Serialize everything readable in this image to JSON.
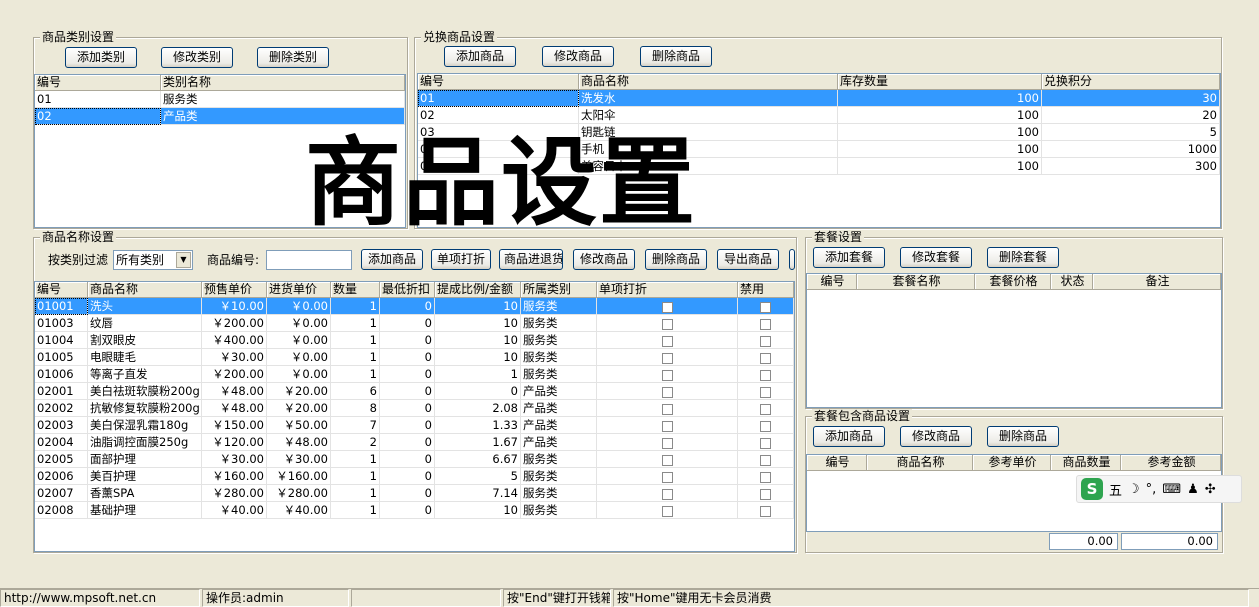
{
  "category_panel": {
    "title": "商品类别设置",
    "buttons": [
      "添加类别",
      "修改类别",
      "删除类别"
    ],
    "columns": [
      "编号",
      "类别名称"
    ],
    "rows": [
      [
        "01",
        "服务类"
      ],
      [
        "02",
        "产品类"
      ]
    ],
    "selected_row": 1
  },
  "exchange_panel": {
    "title": "兑换商品设置",
    "buttons": [
      "添加商品",
      "修改商品",
      "删除商品"
    ],
    "columns": [
      "编号",
      "商品名称",
      "库存数量",
      "兑换积分"
    ],
    "rows": [
      [
        "01",
        "洗发水",
        "100",
        "30"
      ],
      [
        "02",
        "太阳伞",
        "100",
        "20"
      ],
      [
        "03",
        "钥匙链",
        "100",
        "5"
      ],
      [
        "0",
        "手机",
        "100",
        "1000"
      ],
      [
        "0",
        "美容日卡",
        "100",
        "300"
      ]
    ],
    "selected_row": 0
  },
  "watermark": "商品设置",
  "product_panel": {
    "title": "商品名称设置",
    "filter_label": "按类别过滤",
    "filter_value": "所有类别",
    "code_label": "商品编号:",
    "code_value": "",
    "buttons": [
      "添加商品",
      "单项打折",
      "商品进退货",
      "修改商品",
      "删除商品",
      "导出商品"
    ],
    "columns": [
      "编号",
      "商品名称",
      "预售单价",
      "进货单价",
      "数量",
      "最低折扣",
      "提成比例/金额",
      "所属类别",
      "单项打折",
      "禁用"
    ],
    "rows": [
      [
        "01001",
        "洗头",
        "￥10.00",
        "￥0.00",
        "1",
        "0",
        "10",
        "服务类"
      ],
      [
        "01003",
        "纹唇",
        "￥200.00",
        "￥0.00",
        "1",
        "0",
        "10",
        "服务类"
      ],
      [
        "01004",
        "割双眼皮",
        "￥400.00",
        "￥0.00",
        "1",
        "0",
        "10",
        "服务类"
      ],
      [
        "01005",
        "电眼睫毛",
        "￥30.00",
        "￥0.00",
        "1",
        "0",
        "10",
        "服务类"
      ],
      [
        "01006",
        "等离子直发",
        "￥200.00",
        "￥0.00",
        "1",
        "0",
        "1",
        "服务类"
      ],
      [
        "02001",
        "美白祛斑软膜粉200g",
        "￥48.00",
        "￥20.00",
        "6",
        "0",
        "0",
        "产品类"
      ],
      [
        "02002",
        "抗敏修复软膜粉200g",
        "￥48.00",
        "￥20.00",
        "8",
        "0",
        "2.08",
        "产品类"
      ],
      [
        "02003",
        "美白保湿乳霜180g",
        "￥150.00",
        "￥50.00",
        "7",
        "0",
        "1.33",
        "产品类"
      ],
      [
        "02004",
        "油脂调控面膜250g",
        "￥120.00",
        "￥48.00",
        "2",
        "0",
        "1.67",
        "产品类"
      ],
      [
        "02005",
        "面部护理",
        "￥30.00",
        "￥30.00",
        "1",
        "0",
        "6.67",
        "服务类"
      ],
      [
        "02006",
        "美百护理",
        "￥160.00",
        "￥160.00",
        "1",
        "0",
        "5",
        "服务类"
      ],
      [
        "02007",
        "香薰SPA",
        "￥280.00",
        "￥280.00",
        "1",
        "0",
        "7.14",
        "服务类"
      ],
      [
        "02008",
        "基础护理",
        "￥40.00",
        "￥40.00",
        "1",
        "0",
        "10",
        "服务类"
      ]
    ],
    "selected_row": 0
  },
  "package_panel": {
    "title": "套餐设置",
    "buttons": [
      "添加套餐",
      "修改套餐",
      "删除套餐"
    ],
    "columns": [
      "编号",
      "套餐名称",
      "套餐价格",
      "状态",
      "备注"
    ]
  },
  "package_items_panel": {
    "title": "套餐包含商品设置",
    "buttons": [
      "添加商品",
      "修改商品",
      "删除商品"
    ],
    "columns": [
      "编号",
      "商品名称",
      "参考单价",
      "商品数量",
      "参考金额"
    ],
    "totals": [
      "0.00",
      "0.00"
    ]
  },
  "ime": {
    "mode": "五",
    "icons": [
      "moon-icon",
      "punctuation-icon",
      "keyboard-icon",
      "user-icon",
      "grid-icon"
    ]
  },
  "statusbar": [
    "http://www.mpsoft.net.cn",
    "操作员:admin",
    "",
    "按\"End\"键打开钱箱",
    "按\"Home\"键用无卡会员消费"
  ]
}
